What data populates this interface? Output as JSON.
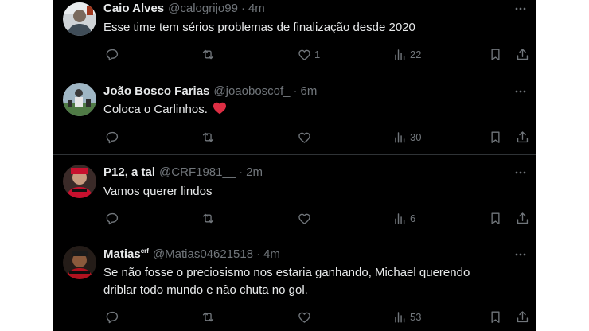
{
  "tweets": [
    {
      "name": "Caio Alves",
      "name_sup": "",
      "handle": "@calogrijo99",
      "time": "4m",
      "text": "Esse time tem sérios problemas de finalização desde 2020",
      "text2": "",
      "likes": "1",
      "views": "22"
    },
    {
      "name": "João Bosco Farias",
      "name_sup": "",
      "handle": "@joaoboscof_",
      "time": "6m",
      "text": "Coloca o Carlinhos.",
      "text2": "",
      "likes": "",
      "views": "30"
    },
    {
      "name": "P12, a tal",
      "name_sup": "",
      "handle": "@CRF1981__",
      "time": "2m",
      "text": "Vamos querer lindos",
      "text2": "",
      "likes": "",
      "views": "6"
    },
    {
      "name": "Matias",
      "name_sup": "crf",
      "handle": "@Matias04621518",
      "time": "4m",
      "text": "Se não fosse o preciosismo nos estaria ganhando, Michael querendo",
      "text2": "driblar todo mundo e não chuta no gol.",
      "likes": "",
      "views": "53"
    }
  ],
  "separator": "·",
  "icons": [
    "more-icon",
    "reply-icon",
    "retweet-icon",
    "like-icon",
    "views-icon",
    "bookmark-icon",
    "share-icon",
    "heart-emoji-icon"
  ],
  "colors": {
    "background": "#000000",
    "text": "#e7e9ea",
    "muted": "#71767b",
    "divider": "#2f3336",
    "heart": "#f91880"
  }
}
